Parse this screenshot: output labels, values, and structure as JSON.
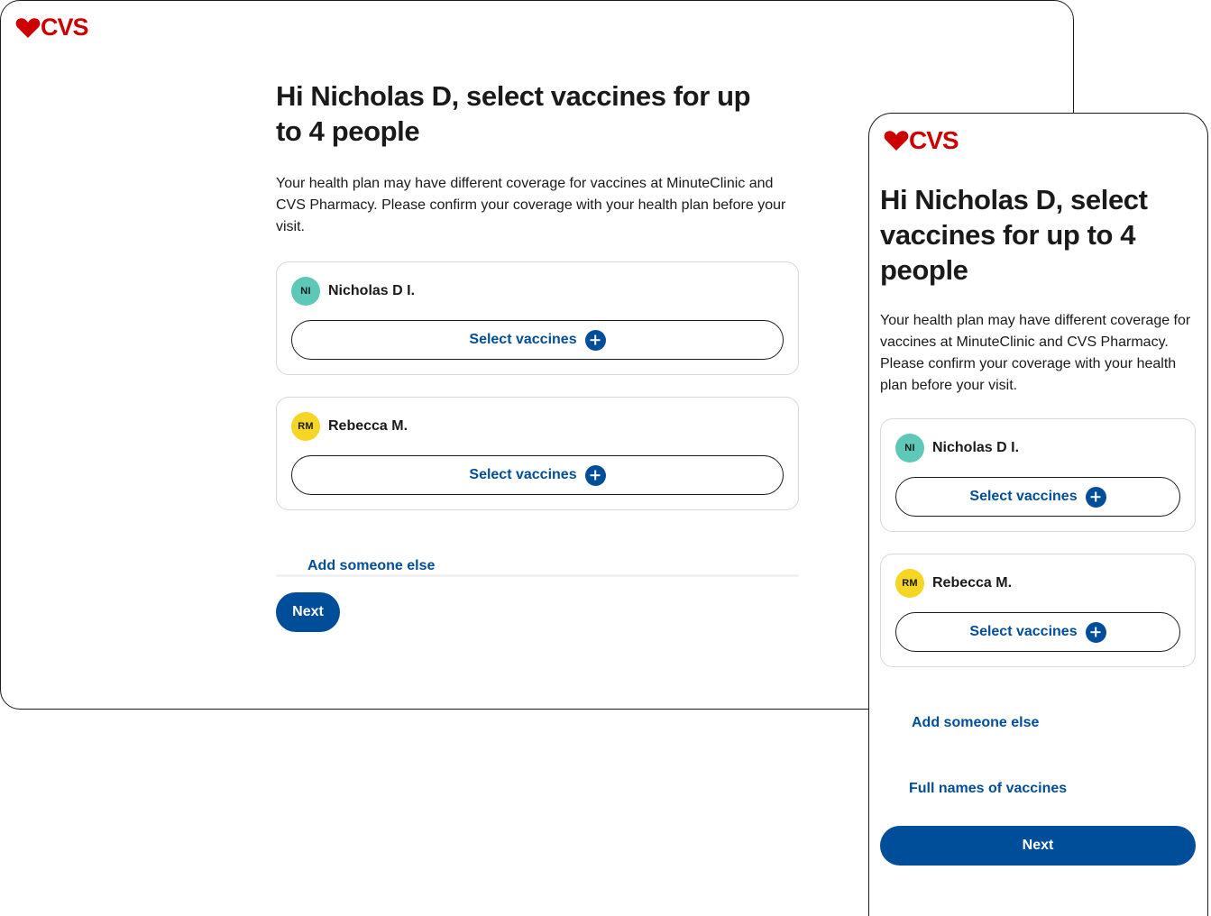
{
  "brand": {
    "logo_text": "CVS",
    "logo_color": "#cc0000",
    "accent": "#004d99"
  },
  "heading": "Hi Nicholas D, select vaccines for up to 4 people",
  "description": "Your health plan may have different coverage for vaccines at MinuteClinic and CVS Pharmacy. Please confirm your coverage with your health plan before your visit.",
  "people": [
    {
      "initials": "NI",
      "name": "Nicholas D I.",
      "avatar_color": "#5ec8b8",
      "button_label": "Select vaccines"
    },
    {
      "initials": "RM",
      "name": "Rebecca M.",
      "avatar_color": "#f5d624",
      "button_label": "Select vaccines"
    }
  ],
  "add_someone_label": "Add someone else",
  "full_names_label": "Full names of vaccines",
  "next_label": "Next",
  "icons": {
    "logo": "heart-icon",
    "add": "plus-circle-icon"
  }
}
